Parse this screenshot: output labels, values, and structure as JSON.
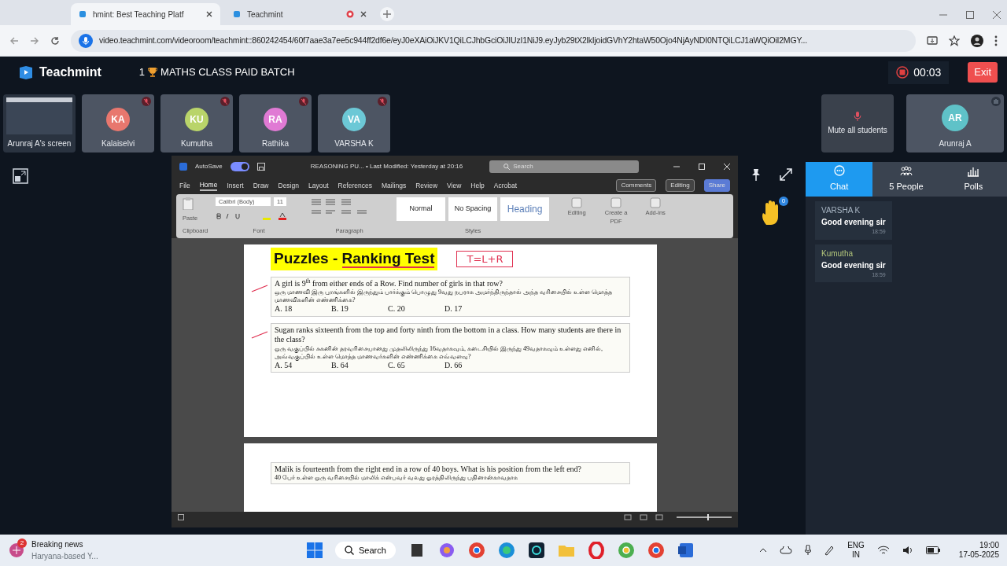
{
  "browser": {
    "tabs": [
      {
        "title": "hmint: Best Teaching Platf",
        "selected": true
      },
      {
        "title": "Teachmint",
        "selected": false
      }
    ],
    "url": "video.teachmint.com/videoroom/teachmint::860242454/60f7aae3a7ee5c944ff2df6e/eyJ0eXAiOiJKV1QiLCJhbGciOiJIUzI1NiJ9.eyJyb29tX2lkIjoidGVhY2htaW50Ojo4NjAyNDI0NTQiLCJ1aWQiOiI2MGY..."
  },
  "header": {
    "brand": "Teachmint",
    "class_number": "1",
    "class_title": "MATHS CLASS PAID BATCH",
    "timer": "00:03",
    "exit": "Exit"
  },
  "participants": [
    {
      "kind": "screen",
      "name": "Arunraj A's screen"
    },
    {
      "kind": "avatar",
      "initials": "KA",
      "name": "Kalaiselvi",
      "color": "#e8776e"
    },
    {
      "kind": "avatar",
      "initials": "KU",
      "name": "Kumutha",
      "color": "#b9d46a"
    },
    {
      "kind": "avatar",
      "initials": "RA",
      "name": "Rathika",
      "color": "#e07ad4"
    },
    {
      "kind": "avatar",
      "initials": "VA",
      "name": "VARSHA K",
      "color": "#6cc8d6"
    }
  ],
  "mute_all": "Mute all students",
  "host": {
    "initials": "AR",
    "name": "Arunraj A",
    "color": "#5fc2c8"
  },
  "word": {
    "autosave": "AutoSave",
    "autosave_on": true,
    "title": "REASONING PU...  •  Last Modified: Yesterday at 20:16",
    "search_placeholder": "Search",
    "ribbon_tabs": [
      {
        "label": "File",
        "selected": false
      },
      {
        "label": "Home",
        "selected": true
      },
      {
        "label": "Insert",
        "selected": false
      },
      {
        "label": "Draw",
        "selected": false
      },
      {
        "label": "Design",
        "selected": false
      },
      {
        "label": "Layout",
        "selected": false
      },
      {
        "label": "References",
        "selected": false
      },
      {
        "label": "Mailings",
        "selected": false
      },
      {
        "label": "Review",
        "selected": false
      },
      {
        "label": "View",
        "selected": false
      },
      {
        "label": "Help",
        "selected": false
      },
      {
        "label": "Acrobat",
        "selected": false
      }
    ],
    "zoom_slider": {
      "level": 0.55
    },
    "comments": "Comments",
    "editing_mode": "Editing",
    "share": "Share",
    "paste": "Paste",
    "font": "Calibri (Body)",
    "font_size": "11",
    "styles": [
      "Normal",
      "No Spacing",
      "Heading"
    ],
    "big_buttons": [
      "Editing",
      "Create a PDF",
      "Add-ins"
    ],
    "groups": [
      "Clipboard",
      "Font",
      "Paragraph",
      "Styles"
    ],
    "doc": {
      "title_start": "Puzzles - ",
      "title_end": "Ranking Test",
      "note": "T=L+R",
      "questions": [
        {
          "english": "A girl is 9$^{th}$ from either ends of a Row. Find number of girls in that row?",
          "tamil": "ஒரு மாணவி இரு புறங்களில் இருந்தும் பார்க்கும் பொழுது 9வது நபராக அமர்ந்திருந்தால் அந்த வரிசையில் உள்ள மொத்த மாணவிகளின் எண்ணிக்கை?",
          "options": [
            "A. 18",
            "B. 19",
            "C. 20",
            "D. 17"
          ],
          "ticked": true
        },
        {
          "english": "Sugan ranks sixteenth from the top and forty ninth from the bottom in a class. How many students are there in the class?",
          "tamil": "ஒரு வகுப்பில் சுகனின் தரவரிசையானது முதலிலிருந்து 16வதாகவும், கடைசியில் இருந்து 49வதாகவும் உள்ளது எனில், அவ்வகுப்பில் உள்ள மொத்த மாணவர்களின் எண்ணிக்கை எவ்வளவு?",
          "options": [
            "A. 54",
            "B. 64",
            "C. 65",
            "D. 66"
          ],
          "ticked": true
        }
      ],
      "next_page": {
        "english": "Malik is fourteenth from the right end in a row of 40 boys. What is his position from the left end?",
        "tamil": "40 பேர் உள்ள ஒரு வரிசையில் மாலிக் என்பவர் வலது ஓரத்திலிருந்து பதினான்காவதாக"
      }
    }
  },
  "hand_count": "0",
  "panel": {
    "tabs": [
      {
        "label": "Chat",
        "kind": "chat",
        "selected": true
      },
      {
        "label": "5 People",
        "kind": "people",
        "selected": false
      },
      {
        "label": "Polls",
        "kind": "polls",
        "selected": false
      }
    ],
    "messages": [
      {
        "sender": "VARSHA K",
        "color": "#a7b4c2",
        "text": "Good evening sir",
        "time": "18:59"
      },
      {
        "sender": "Kumutha",
        "color": "#b4c77c",
        "text": "Good evening sir",
        "time": "18:59"
      }
    ]
  },
  "taskbar": {
    "news_badge": "2",
    "news_title": "Breaking news",
    "news_text": "Haryana-based Y...",
    "search": "Search",
    "lang": "ENG",
    "region": "IN",
    "time": "19:00",
    "date": "17-05-2025"
  }
}
